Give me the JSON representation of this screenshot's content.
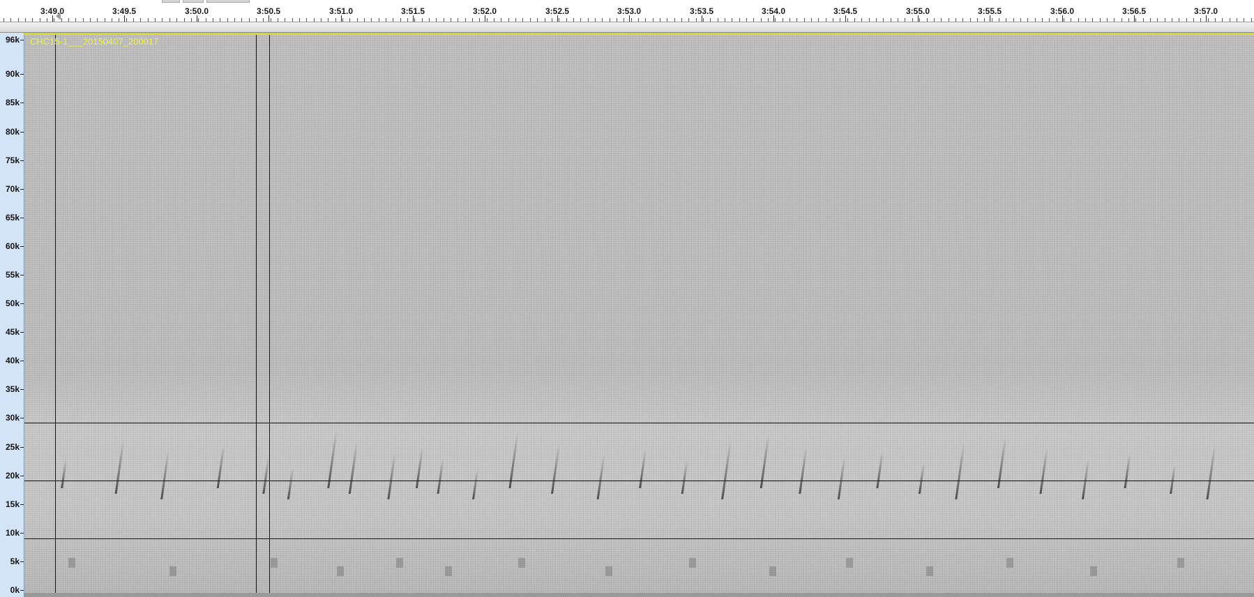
{
  "timeline": {
    "ticks": [
      "3:49.0",
      "3:49.5",
      "3:50.0",
      "3:50.5",
      "3:51.0",
      "3:51.5",
      "3:52.0",
      "3:52.5",
      "3:53.0",
      "3:53.5",
      "3:54.0",
      "3:54.5",
      "3:55.0",
      "3:55.5",
      "3:56.0",
      "3:56.5",
      "3:57.0"
    ]
  },
  "frequency_axis": {
    "labels": [
      "96k",
      "90k",
      "85k",
      "80k",
      "75k",
      "70k",
      "65k",
      "60k",
      "55k",
      "50k",
      "45k",
      "40k",
      "35k",
      "30k",
      "25k",
      "20k",
      "15k",
      "10k",
      "5k",
      "0k"
    ]
  },
  "track": {
    "name": "CHC15-1___20150407_200017"
  },
  "colors": {
    "frequency_axis_bg": "#d3e4f6",
    "spectrogram_bg": "#bdbdbd",
    "track_name": "#f3f33c",
    "guide_line": "#111111"
  }
}
